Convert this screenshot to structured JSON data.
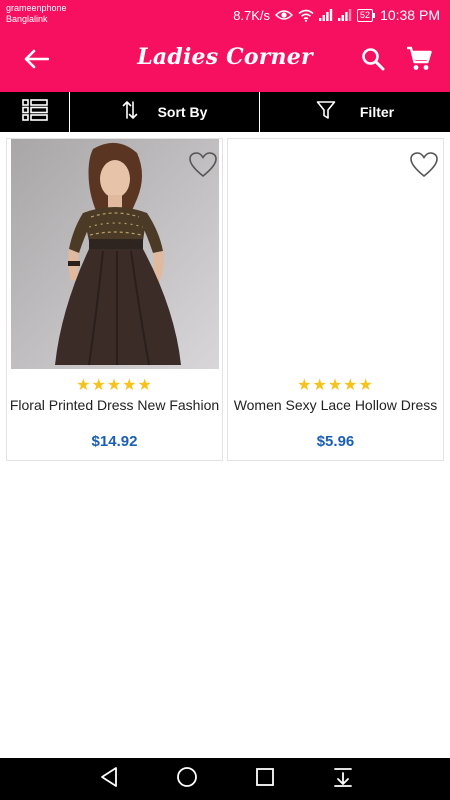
{
  "status_bar": {
    "carrier_1": "grameenphone",
    "carrier_2": "Banglalink",
    "speed": "8.7K/s",
    "battery": "52",
    "time": "10:38 PM",
    "icons": [
      "eye-icon",
      "wifi-icon",
      "signal-icon",
      "signal-icon",
      "battery-icon"
    ]
  },
  "app_bar": {
    "title": "Ladies Corner",
    "icons": [
      "back-arrow-icon",
      "search-icon",
      "cart-icon"
    ],
    "background": "#f7105f"
  },
  "toolbar": {
    "sort_label": "Sort By",
    "filter_label": "Filter",
    "icons": [
      "list-view-icon",
      "sort-icon",
      "filter-icon"
    ]
  },
  "products": [
    {
      "name": "Floral Printed Dress New Fashion",
      "price": "$14.92",
      "stars": "★★★★★",
      "rating": 5,
      "has_image": true
    },
    {
      "name": "Women Sexy Lace Hollow Dress",
      "price": "$5.96",
      "stars": "★★★★★",
      "rating": 5,
      "has_image": false
    }
  ],
  "colors": {
    "accent": "#f7105f",
    "price": "#1a5fb4",
    "star": "#f7c21a"
  },
  "nav_bar": {
    "icons": [
      "back-triangle-icon",
      "home-circle-icon",
      "recents-square-icon",
      "notification-pull-icon"
    ]
  }
}
